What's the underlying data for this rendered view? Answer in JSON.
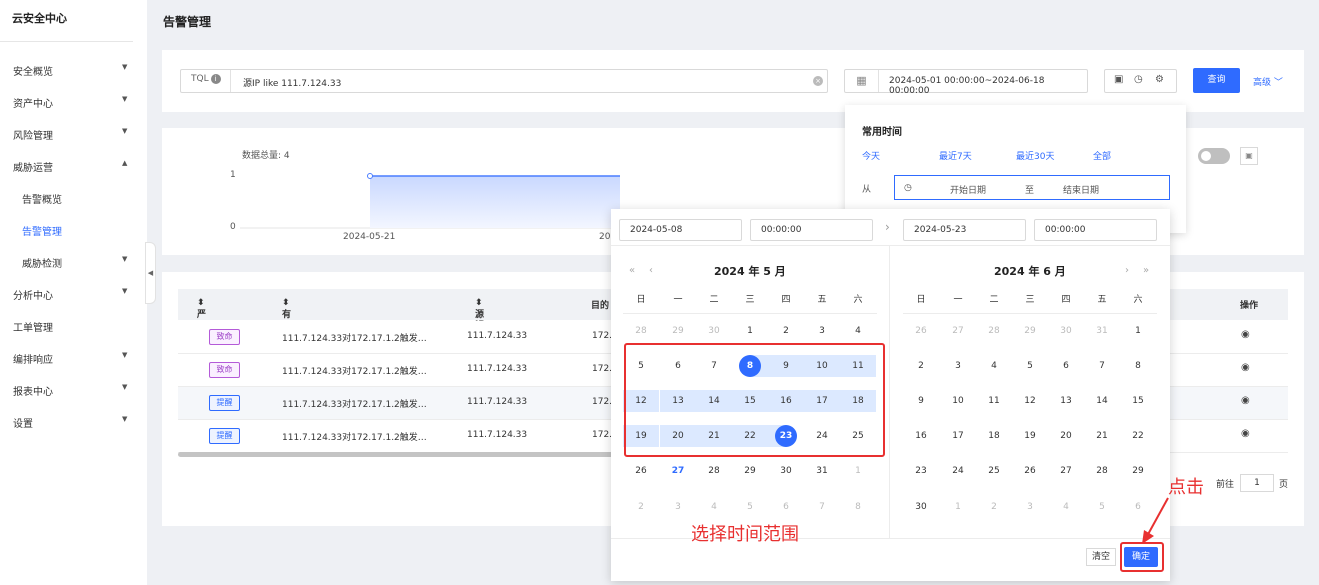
{
  "sidebar": {
    "brand": "云安全中心",
    "items": [
      {
        "label": "安全概览",
        "caret": "▼"
      },
      {
        "label": "资产中心",
        "caret": "▼"
      },
      {
        "label": "风险管理",
        "caret": "▼"
      },
      {
        "label": "威胁运营",
        "caret": "▲"
      },
      {
        "label": "告警概览",
        "caret": ""
      },
      {
        "label": "告警管理",
        "caret": ""
      },
      {
        "label": "威胁检测",
        "caret": "▼"
      },
      {
        "label": "分析中心",
        "caret": "▼"
      },
      {
        "label": "工单管理",
        "caret": ""
      },
      {
        "label": "编排响应",
        "caret": "▼"
      },
      {
        "label": "报表中心",
        "caret": "▼"
      },
      {
        "label": "设置",
        "caret": "▼"
      }
    ]
  },
  "page": {
    "title": "告警管理"
  },
  "search": {
    "tql_label": "TQL",
    "query": "源IP like 111.7.124.33",
    "date_range": "2024-05-01 00:00:00~2024-06-18 00:00:00",
    "query_button": "查询",
    "advanced": "高级"
  },
  "quick_time": {
    "heading": "常用时间",
    "options": [
      "今天",
      "最近7天",
      "最近30天",
      "全部"
    ],
    "from_label": "从",
    "start_placeholder": "开始日期",
    "to_label": "至",
    "end_placeholder": "结束日期"
  },
  "chart": {
    "total_label": "数据总量: 4",
    "y_ticks": [
      "1",
      "0"
    ],
    "x_ticks": [
      "2024-05-21",
      "20"
    ]
  },
  "table": {
    "headers": [
      "严重等级",
      "有效告警名称",
      "源IP",
      "目的",
      "操作"
    ],
    "rows": [
      {
        "level": "致命",
        "name": "111.7.124.33对172.17.1.2触发…",
        "src": "111.7.124.33",
        "dst": "172."
      },
      {
        "level": "致命",
        "name": "111.7.124.33对172.17.1.2触发…",
        "src": "111.7.124.33",
        "dst": "172."
      },
      {
        "level": "提醒",
        "name": "111.7.124.33对172.17.1.2触发…",
        "src": "111.7.124.33",
        "dst": "172."
      },
      {
        "level": "提醒",
        "name": "111.7.124.33对172.17.1.2触发…",
        "src": "111.7.124.33",
        "dst": "172."
      }
    ],
    "goto_label": "前往",
    "page_input": "1",
    "page_unit": "页"
  },
  "datepicker": {
    "start_date": "2024-05-08",
    "start_time": "00:00:00",
    "end_date": "2024-05-23",
    "end_time": "00:00:00",
    "left_title": "2024 年 5 月",
    "right_title": "2024 年 6 月",
    "weekdays": [
      "日",
      "一",
      "二",
      "三",
      "四",
      "五",
      "六"
    ],
    "left_days": [
      [
        "28",
        "29",
        "30",
        "1",
        "2",
        "3",
        "4"
      ],
      [
        "5",
        "6",
        "7",
        "8",
        "9",
        "10",
        "11"
      ],
      [
        "12",
        "13",
        "14",
        "15",
        "16",
        "17",
        "18"
      ],
      [
        "19",
        "20",
        "21",
        "22",
        "23",
        "24",
        "25"
      ],
      [
        "26",
        "27",
        "28",
        "29",
        "30",
        "31",
        "1"
      ],
      [
        "2",
        "3",
        "4",
        "5",
        "6",
        "7",
        "8"
      ]
    ],
    "right_days": [
      [
        "26",
        "27",
        "28",
        "29",
        "30",
        "31",
        "1"
      ],
      [
        "2",
        "3",
        "4",
        "5",
        "6",
        "7",
        "8"
      ],
      [
        "9",
        "10",
        "11",
        "12",
        "13",
        "14",
        "15"
      ],
      [
        "16",
        "17",
        "18",
        "19",
        "20",
        "21",
        "22"
      ],
      [
        "23",
        "24",
        "25",
        "26",
        "27",
        "28",
        "29"
      ],
      [
        "30",
        "1",
        "2",
        "3",
        "4",
        "5",
        "6"
      ]
    ],
    "clear_button": "清空",
    "ok_button": "确定"
  },
  "annotations": {
    "select_range": "选择时间范围",
    "click": "点击"
  },
  "colors": {
    "accent": "#2f6bff",
    "annotation": "#e83030",
    "fatal": "#9b3cc6"
  }
}
